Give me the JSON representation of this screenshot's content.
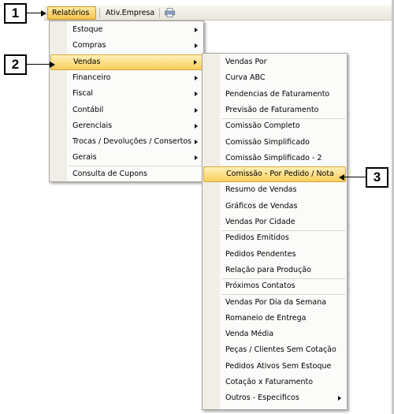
{
  "menubar": {
    "items": [
      "Relatórios",
      "Ativ.Empresa"
    ],
    "printer_icon": "printer-icon"
  },
  "callouts": [
    "1",
    "2",
    "3"
  ],
  "relatorios_menu": {
    "items": [
      {
        "label": "Estoque",
        "submenu": true
      },
      {
        "label": "Compras",
        "submenu": true
      },
      {
        "label": "Vendas",
        "submenu": true,
        "highlighted": true
      },
      {
        "label": "Financeiro",
        "submenu": true
      },
      {
        "label": "Fiscal",
        "submenu": true
      },
      {
        "label": "Contábil",
        "submenu": true
      },
      {
        "label": "Gerenciais",
        "submenu": true
      },
      {
        "label": "Trocas / Devoluções / Consertos",
        "submenu": true
      },
      {
        "label": "Gerais",
        "submenu": true
      },
      {
        "label": "Consulta de Cupons",
        "submenu": false
      }
    ]
  },
  "vendas_menu": {
    "items": [
      {
        "label": "Vendas Por"
      },
      {
        "label": "Curva ABC"
      },
      {
        "label": "Pendencias de Faturamento"
      },
      {
        "label": "Previsão de Faturamento"
      },
      {
        "label": "Comissão Completo"
      },
      {
        "label": "Comissão Simplificado"
      },
      {
        "label": "Comissão Simplificado - 2"
      },
      {
        "label": "Comissão - Por Pedido / Nota",
        "highlighted": true
      },
      {
        "label": "Resumo de Vendas"
      },
      {
        "label": "Gráficos de Vendas"
      },
      {
        "label": "Vendas Por Cidade"
      },
      {
        "label": "Pedidos Emitidos"
      },
      {
        "label": "Pedidos Pendentes"
      },
      {
        "label": "Relação para Produção"
      },
      {
        "label": "Próximos Contatos"
      },
      {
        "label": "Vendas Por Dia da Semana"
      },
      {
        "label": "Romaneio de Entrega"
      },
      {
        "label": "Venda Média"
      },
      {
        "label": "Peças / Clientes Sem Cotação"
      },
      {
        "label": "Pedidos Ativos Sem Estoque"
      },
      {
        "label": "Cotação x Faturamento"
      },
      {
        "label": "Outros - Especificos",
        "submenu": true
      }
    ]
  },
  "colors": {
    "highlight": "#f9cf5e",
    "menu_bg": "#fbfbf9"
  }
}
